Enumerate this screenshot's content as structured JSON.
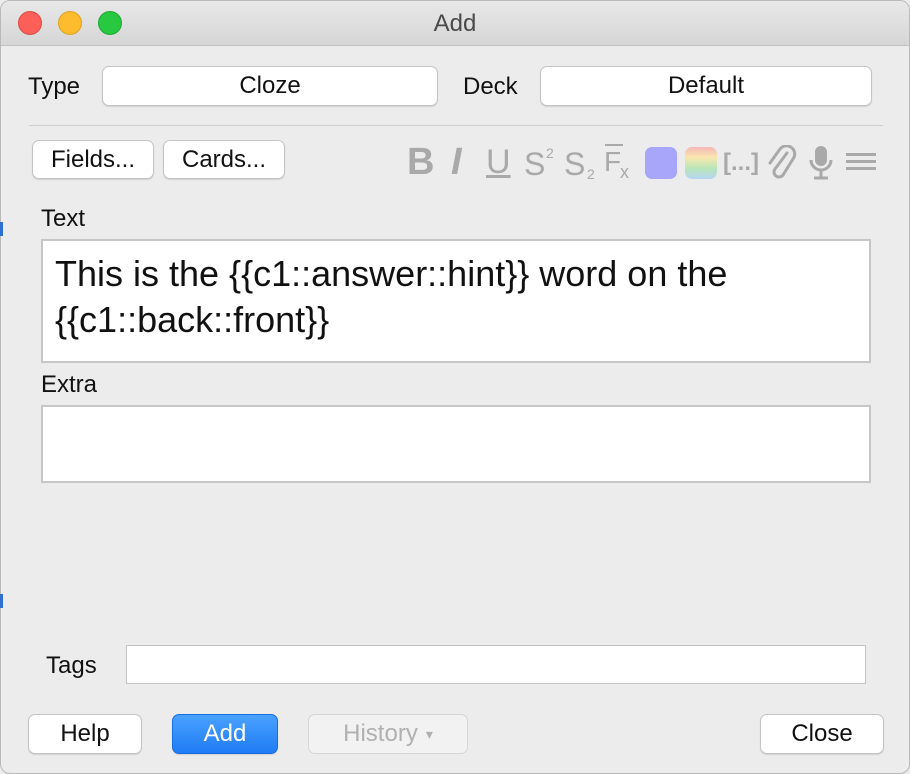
{
  "window": {
    "title": "Add"
  },
  "top": {
    "type_label": "Type",
    "type_value": "Cloze",
    "deck_label": "Deck",
    "deck_value": "Default"
  },
  "toolbar": {
    "fields_button": "Fields...",
    "cards_button": "Cards...",
    "icons": [
      "bold-icon",
      "italic-icon",
      "underline-icon",
      "superscript-icon",
      "subscript-icon",
      "clear-format-icon",
      "text-color-icon",
      "highlight-color-icon",
      "cloze-icon",
      "attachment-icon",
      "record-audio-icon",
      "more-icon"
    ],
    "bold_glyph": "B",
    "italic_glyph": "I",
    "underline_glyph": "U",
    "cloze_glyph": "[...]"
  },
  "fields": [
    {
      "label": "Text",
      "value": "This is the {{c1::answer::hint}} word on the {{c1::back::front}}"
    },
    {
      "label": "Extra",
      "value": ""
    }
  ],
  "tags": {
    "label": "Tags",
    "value": ""
  },
  "footer": {
    "help_button": "Help",
    "add_button": "Add",
    "history_button": "History",
    "history_arrow": "▾",
    "close_button": "Close"
  },
  "colors": {
    "accent_blue": "#1f7cf3",
    "text_color_swatch": "#a7a6fb",
    "traffic_close": "#fc5f57",
    "traffic_minimize": "#fdbc2e",
    "traffic_maximize": "#28c840"
  }
}
